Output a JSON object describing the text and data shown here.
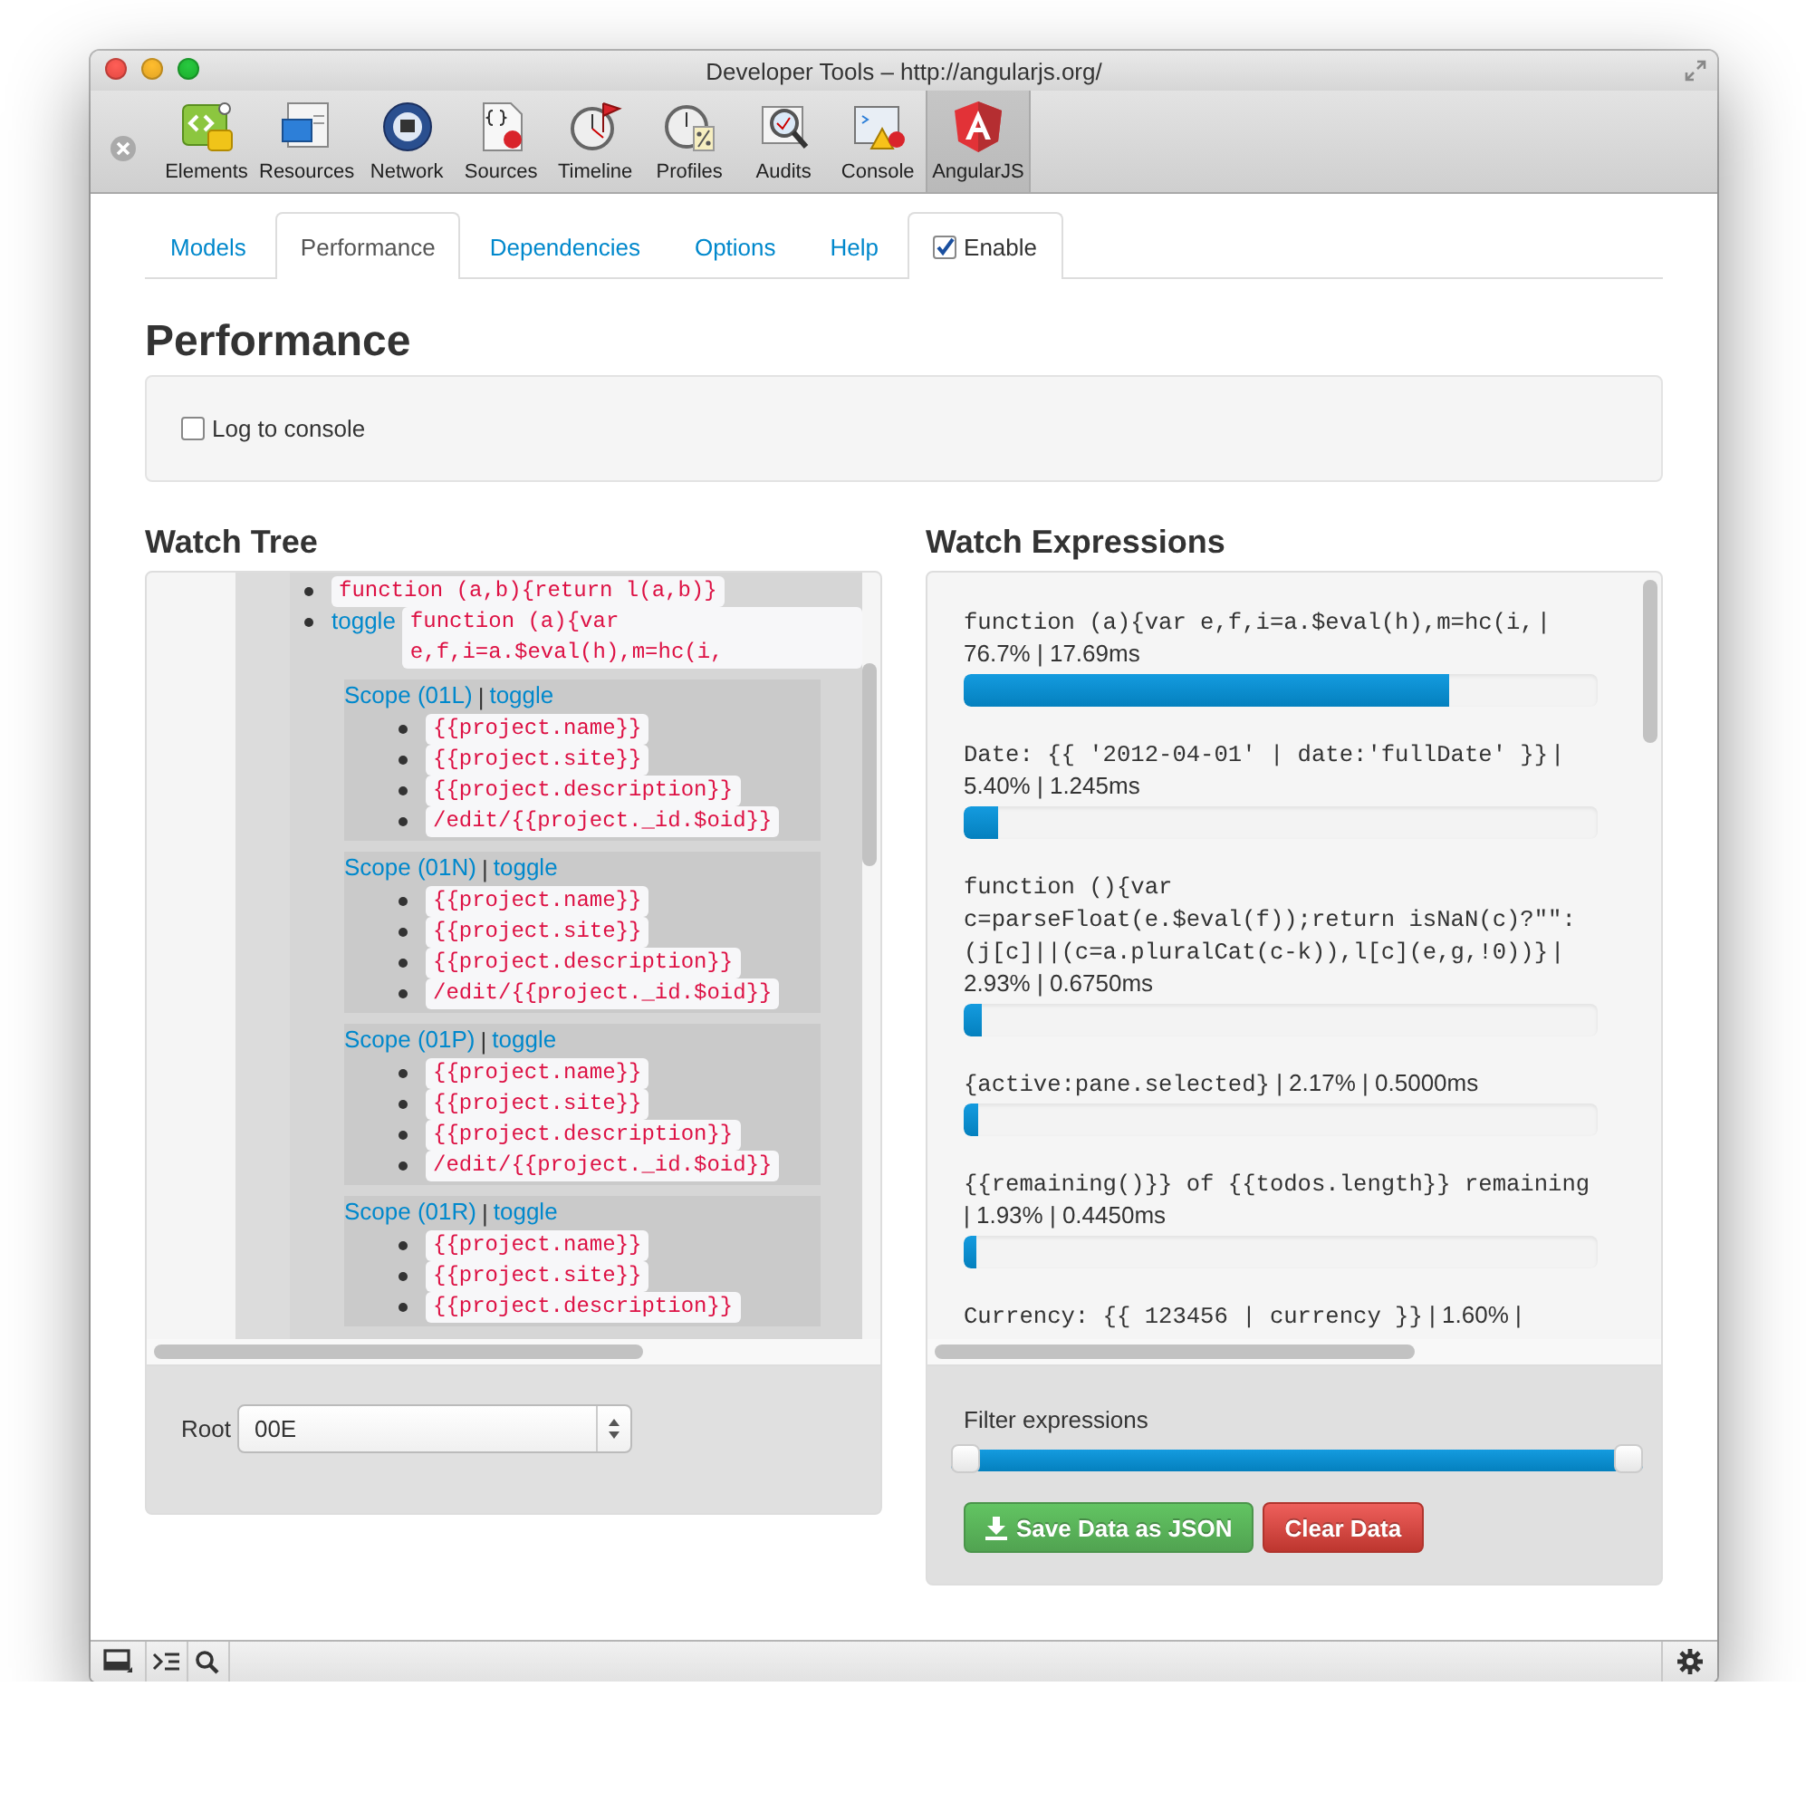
{
  "window": {
    "title": "Developer Tools – http://angularjs.org/"
  },
  "toolbar": {
    "tools": [
      {
        "label": "Elements",
        "kind": "elements",
        "selected": false
      },
      {
        "label": "Resources",
        "kind": "resources",
        "selected": false
      },
      {
        "label": "Network",
        "kind": "network",
        "selected": false
      },
      {
        "label": "Sources",
        "kind": "sources",
        "selected": false
      },
      {
        "label": "Timeline",
        "kind": "timeline",
        "selected": false
      },
      {
        "label": "Profiles",
        "kind": "profiles",
        "selected": false
      },
      {
        "label": "Audits",
        "kind": "audits",
        "selected": false
      },
      {
        "label": "Console",
        "kind": "console",
        "selected": false
      },
      {
        "label": "AngularJS",
        "kind": "angular",
        "selected": true
      }
    ]
  },
  "tabs": [
    {
      "label": "Models",
      "kind": "tab",
      "selected": false
    },
    {
      "label": "Performance",
      "kind": "tab",
      "selected": true
    },
    {
      "label": "Dependencies",
      "kind": "tab",
      "selected": false
    },
    {
      "label": "Options",
      "kind": "tab",
      "selected": false
    },
    {
      "label": "Help",
      "kind": "tab",
      "selected": false
    },
    {
      "label": "Enable",
      "kind": "checkbox",
      "checked": true
    }
  ],
  "heading": "Performance",
  "log_to_console": {
    "label": "Log to console",
    "checked": false
  },
  "watch_tree": {
    "title": "Watch Tree",
    "bindings": [
      {
        "code": "function (a,b){return l(a,b)}"
      },
      {
        "toggle": "toggle",
        "code": "function (a){var e,f,i=a.$eval(h),m=hc(i,"
      }
    ],
    "scopes": [
      {
        "label": "Scope (01L)",
        "separator": "|",
        "toggle": "toggle",
        "bindings": [
          "{{project.name}}",
          "{{project.site}}",
          "{{project.description}}",
          "/edit/{{project._id.$oid}}"
        ]
      },
      {
        "label": "Scope (01N)",
        "separator": "|",
        "toggle": "toggle",
        "bindings": [
          "{{project.name}}",
          "{{project.site}}",
          "{{project.description}}",
          "/edit/{{project._id.$oid}}"
        ]
      },
      {
        "label": "Scope (01P)",
        "separator": "|",
        "toggle": "toggle",
        "bindings": [
          "{{project.name}}",
          "{{project.site}}",
          "{{project.description}}",
          "/edit/{{project._id.$oid}}"
        ]
      },
      {
        "label": "Scope (01R)",
        "separator": "|",
        "toggle": "toggle",
        "bindings": [
          "{{project.name}}",
          "{{project.site}}",
          "{{project.description}}"
        ]
      }
    ],
    "root": {
      "label": "Root",
      "value": "00E"
    }
  },
  "watch_expressions": {
    "title": "Watch Expressions",
    "items": [
      {
        "expression": "function (a){var e,f,i=a.$eval(h),m=hc(i,",
        "stats": "| 76.7% | 17.69ms",
        "level": 0.767
      },
      {
        "expression": "Date: {{ '2012-04-01' | date:'fullDate' }}",
        "stats": "| 5.40% | 1.245ms",
        "level": 0.054
      },
      {
        "expression": "function (){var c=parseFloat(e.$eval(f));return isNaN(c)?\"\":(j[c]||(c=a.pluralCat(c-k)),l[c](e,g,!0))}",
        "stats": "| 2.93% | 0.6750ms",
        "level": 0.0293
      },
      {
        "expression": "{active:pane.selected}",
        "stats": "| 2.17% | 0.5000ms",
        "level": 0.0217
      },
      {
        "expression": "{{remaining()}} of {{todos.length}} remaining",
        "stats": "| 1.93% | 0.4450ms",
        "level": 0.0193
      },
      {
        "expression": "Currency: {{ 123456 | currency }}",
        "stats": "| 1.60% |"
      }
    ],
    "filter": {
      "label": "Filter expressions",
      "start": {
        "level": 0
      },
      "end": {
        "level": 1
      }
    },
    "buttons": [
      {
        "label": "Save Data as JSON",
        "kind": "save"
      },
      {
        "label": "Clear Data",
        "kind": "clear"
      }
    ]
  }
}
